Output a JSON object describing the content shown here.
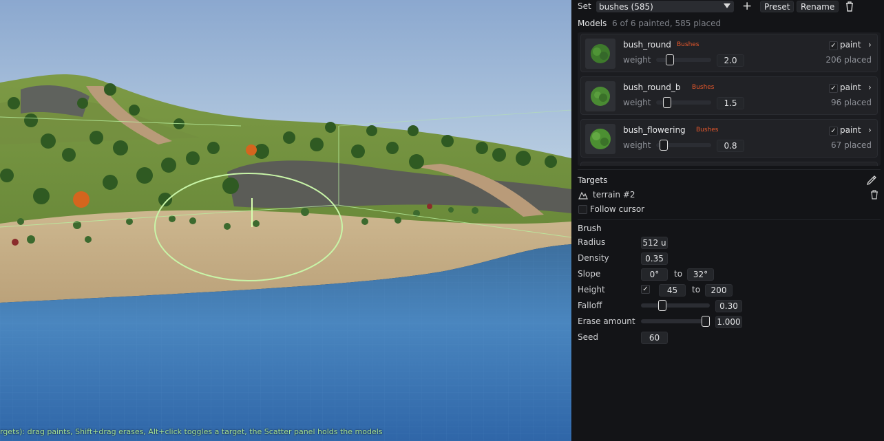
{
  "viewport": {
    "status_text": "rgets): drag paints, Shift+drag erases, Alt+click toggles a target, the Scatter panel holds the models"
  },
  "panel": {
    "set": {
      "label": "Set",
      "selected": "bushes (585)",
      "add_icon": "plus-icon",
      "preset_label": "Preset",
      "rename_label": "Rename",
      "delete_icon": "trash-icon"
    },
    "models": {
      "title": "Models",
      "summary": "6 of 6 painted, 585 placed",
      "items": [
        {
          "name": "bush_round",
          "tag": "Bushes",
          "weight_label": "weight",
          "weight": "2.0",
          "weight_level": 0.2,
          "paint_label": "paint",
          "painted": true,
          "placed": "206 placed"
        },
        {
          "name": "bush_round_b",
          "tag": "Bushes",
          "weight_label": "weight",
          "weight": "1.5",
          "weight_level": 0.15,
          "paint_label": "paint",
          "painted": true,
          "placed": "96 placed"
        },
        {
          "name": "bush_flowering",
          "tag": "Bushes",
          "weight_label": "weight",
          "weight": "0.8",
          "weight_level": 0.08,
          "paint_label": "paint",
          "painted": true,
          "placed": "67 placed"
        }
      ]
    },
    "targets": {
      "title": "Targets",
      "picker_icon": "eyedropper-icon",
      "item_icon": "terrain-icon",
      "item": "terrain #2",
      "remove_icon": "trash-icon",
      "follow_cursor_label": "Follow cursor",
      "follow_cursor": false
    },
    "brush": {
      "title": "Brush",
      "radius_label": "Radius",
      "radius": "512 u",
      "density_label": "Density",
      "density": "0.35",
      "slope_label": "Slope",
      "slope_min": "0°",
      "slope_to": "to",
      "slope_max": "32°",
      "height_label": "Height",
      "height_enabled": true,
      "height_min": "45",
      "height_to": "to",
      "height_max": "200",
      "falloff_label": "Falloff",
      "falloff": "0.30",
      "falloff_level": 0.3,
      "erase_label": "Erase amount",
      "erase": "1.000",
      "erase_level": 1.0,
      "seed_label": "Seed",
      "seed": "60"
    }
  },
  "colors": {
    "accent_tag": "#e8582c",
    "brush_ring": "#c8f5a8",
    "panel_bg": "#131417"
  }
}
